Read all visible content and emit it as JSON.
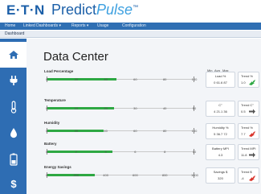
{
  "header": {
    "brand": "E·T·N",
    "product_a": "Predict",
    "product_b": "Pulse",
    "tm": "™"
  },
  "nav": {
    "items": [
      "Home",
      "Linked Dashboards ▾",
      "Reports ▾",
      "Usage",
      "Configuration"
    ]
  },
  "breadcrumb": {
    "label": "Dashboard"
  },
  "main": {
    "title": "Data Center",
    "column_headers": [
      "Min",
      "Avg",
      "Max"
    ]
  },
  "rows": [
    {
      "label": "Load Percentage",
      "ticks": [
        "0",
        "20",
        "40",
        "60",
        "80",
        "100"
      ],
      "fill": 0.47,
      "stat_label": "Load %",
      "stat_value": "0   61.6   87",
      "trend_label": "Trend %",
      "trend_value": "1.0",
      "trend_arrow": "up"
    },
    {
      "label": "Temperature",
      "ticks": [
        "0",
        "10",
        "20",
        "30",
        "40",
        "50"
      ],
      "fill": 0.45,
      "stat_label": "C°",
      "stat_value": "4   21.1   36",
      "trend_label": "Trend C°",
      "trend_value": "0.5",
      "trend_arrow": "right"
    },
    {
      "label": "Humidity",
      "ticks": [
        "0",
        "20",
        "40",
        "60",
        "80",
        "100"
      ],
      "fill": 0.38,
      "stat_label": "Humidity %",
      "stat_value": "5   36.7   72",
      "trend_label": "Trend %",
      "trend_value": "7.7",
      "trend_arrow": "up-red"
    },
    {
      "label": "Battery",
      "ticks": [
        "0",
        "2",
        "4",
        "6",
        "8",
        "10"
      ],
      "fill": 0.44,
      "stat_label": "Battery MPI",
      "stat_value": "4.3",
      "trend_label": "Trend MPI",
      "trend_value": "11.8",
      "trend_arrow": "right"
    },
    {
      "label": "Energy Savings",
      "ticks": [
        "0",
        "200",
        "400",
        "600",
        "800",
        "1000"
      ],
      "fill": 0.32,
      "stat_label": "Savings $",
      "stat_value": "320",
      "trend_label": "Trend $",
      "trend_value": "-4",
      "trend_arrow": "up-red"
    }
  ]
}
